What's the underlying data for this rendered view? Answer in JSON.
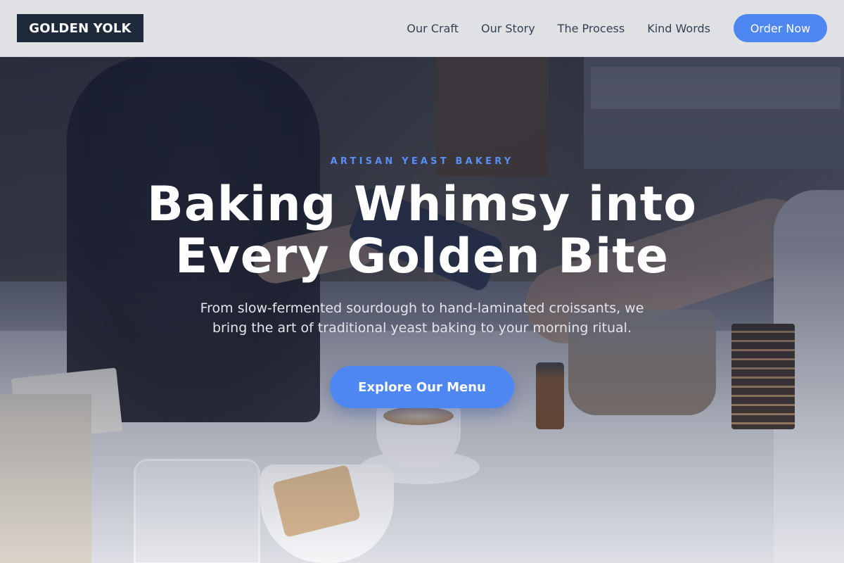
{
  "brand": {
    "logo_text": "GOLDEN YOLK"
  },
  "nav": {
    "links": [
      {
        "label": "Our Craft"
      },
      {
        "label": "Our Story"
      },
      {
        "label": "The Process"
      },
      {
        "label": "Kind Words"
      }
    ],
    "cta_label": "Order Now"
  },
  "hero": {
    "eyebrow": "ARTISAN YEAST BAKERY",
    "headline_line1": "Baking Whimsy into",
    "headline_line2": "Every Golden Bite",
    "subtext_line1": "From slow-fermented sourdough to hand-laminated croissants, we",
    "subtext_line2": "bring the art of traditional yeast baking to your morning ritual.",
    "cta_label": "Explore Our Menu"
  },
  "colors": {
    "accent": "#4f87f2",
    "logo_bg": "#1e293b",
    "nav_bg": "#ecedef",
    "eyebrow": "#5b8ef5"
  }
}
